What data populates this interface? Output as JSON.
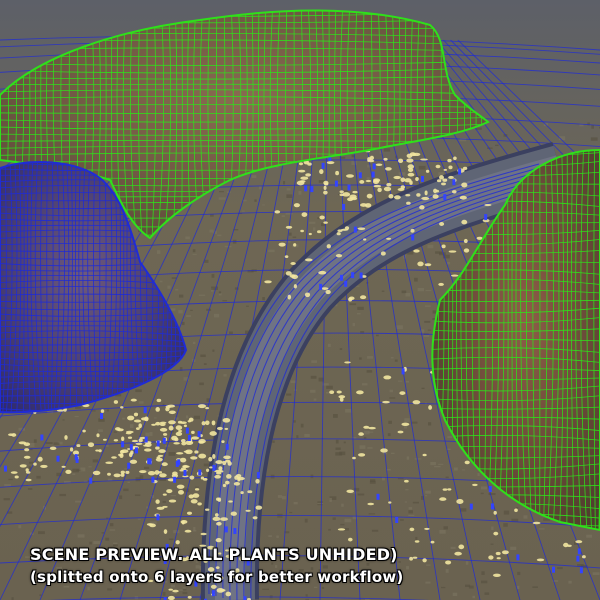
{
  "viewport": {
    "caption_line_1": "SCENE PREVIEW. ALL PLANTS UNHIDED)",
    "caption_line_2": "(splitted onto 6 layers for better workflow)"
  },
  "colors": {
    "ground": "#6b6552",
    "ground_dark": "#4f4a3c",
    "grid_blue": "#1f2bd6",
    "wire_green": "#2fe01a",
    "rock_brown": "#7a5540",
    "rock_purple": "#4a3f8a",
    "road": "#5f6575",
    "plant_yellow": "#f2e6a0",
    "plant_blue": "#3344ff"
  },
  "scene": {
    "objects": [
      {
        "name": "rock-mesa-green-wireframe",
        "wire_color": "green"
      },
      {
        "name": "rock-mound-blue-wireframe",
        "wire_color": "blue"
      },
      {
        "name": "rock-boulder-green-wireframe",
        "wire_color": "green"
      },
      {
        "name": "road-curve",
        "wire_color": "blue"
      },
      {
        "name": "terrain-grid",
        "wire_color": "blue"
      }
    ]
  }
}
